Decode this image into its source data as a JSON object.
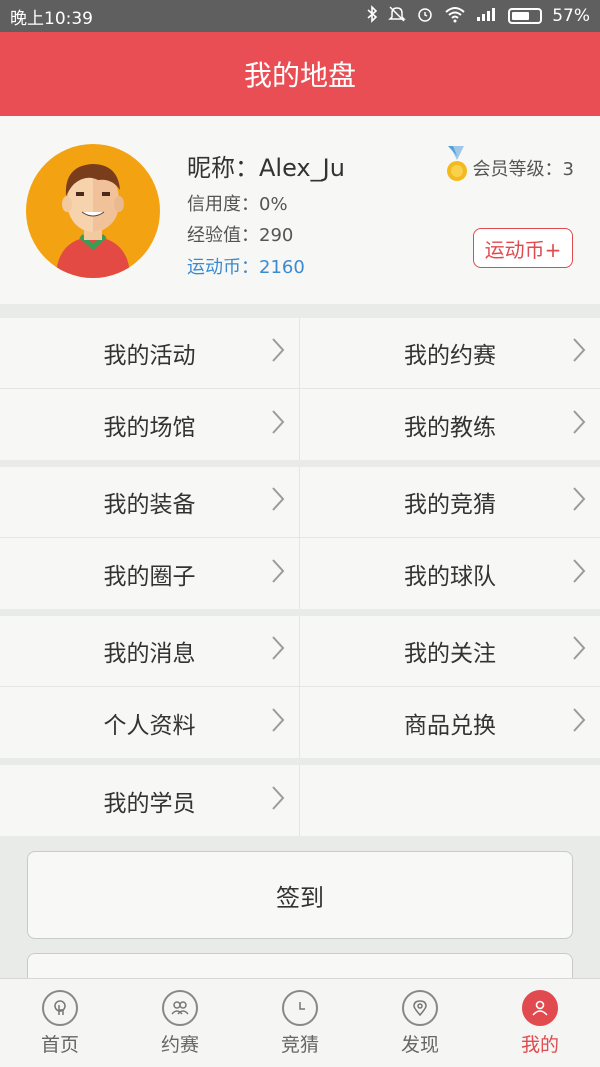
{
  "status_bar": {
    "time": "晚上10:39",
    "battery": "57%"
  },
  "header": {
    "title": "我的地盘"
  },
  "profile": {
    "nickname": "昵称：Alex_Ju",
    "credit": "信用度：0%",
    "experience": "经验值：290",
    "coins": "运动币：2160",
    "level": "会员等级：3",
    "coin_button": "运动币+"
  },
  "menu": [
    [
      "我的活动",
      "我的约赛"
    ],
    [
      "我的场馆",
      "我的教练"
    ],
    [
      "我的装备",
      "我的竞猜"
    ],
    [
      "我的圈子",
      "我的球队"
    ],
    [
      "我的消息",
      "我的关注"
    ],
    [
      "个人资料",
      "商品兑换"
    ],
    [
      "我的学员",
      ""
    ]
  ],
  "signin_button": "签到",
  "tabbar": [
    {
      "label": "首页",
      "icon": "touch-icon"
    },
    {
      "label": "约赛",
      "icon": "people-icon"
    },
    {
      "label": "竞猜",
      "icon": "clock-icon"
    },
    {
      "label": "发现",
      "icon": "location-icon"
    },
    {
      "label": "我的",
      "icon": "user-icon",
      "active": true
    }
  ],
  "colors": {
    "primary": "#e94e55",
    "accent_blue": "#3a8ad1"
  }
}
